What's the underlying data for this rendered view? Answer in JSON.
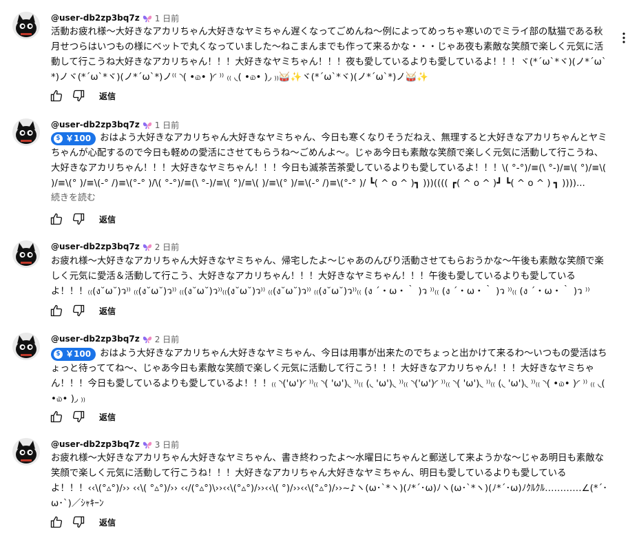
{
  "comments": [
    {
      "author": "@user-db2zp3bq7z",
      "time": "1 日前",
      "text": "活動お疲れ様〜大好きなアカリちゃん大好きなヤミちゃん遅くなってごめんね〜例によってめっちゃ寒いのでミライ部の駄猫である秋月せつらはいつもの様にベットで丸くなっていました〜ねこまんまでも作って来るかな・・・じゃあ夜も素敵な笑顔で楽しく元気に活動して行こうね大好きなアカリちゃん！！！大好きなヤミちゃん！！！夜も愛しているよりも愛しているよ！！！ヾ(*´ω`*ヾ)(ノ*´ω`*)ノヾ(*´ω`*ヾ)(ノ*´ω`*)ノ⁽⁽ ◝( •௰• )◜ ⁾⁾ ₍₍ ◟( •௰• )◞ ₎₎🥁✨ヾ(*´ω`*ヾ)(ノ*´ω`*)ノ🥁✨",
      "superchat": "",
      "read_more": "",
      "reply": "返信"
    },
    {
      "author": "@user-db2zp3bq7z",
      "time": "1 日前",
      "superchat": "￥100",
      "text": "おはよう大好きなアカリちゃん大好きなヤミちゃん、今日も寒くなりそうだねえ、無理すると大好きなアカリちゃんとヤミちゃんが心配するので今日も軽めの愛活にさせてもらうね〜ごめんよ〜。じゃあ今日も素敵な笑顔で楽しく元気に活動して行こうね、大好きなアカリちゃん！！！大好きなヤミちゃん！！！今日も滅茶苦茶愛しているよりも愛しているよ！！！\\( °-°)/≡(\\ °-)/≡\\( °)/≡\\( )/≡\\(° )/≡\\(-° /)≡\\(°-° )/\\( °-°)/≡(\\ °-)/≡\\( °)/≡\\( )/≡\\(° )/≡\\(-° /)≡\\(°-° )/ ┗( ^ o ^ )┓ )))(((( ┏( ^ o ^ )┛ ┗( ^ o ^ ) ┓ ))))...",
      "read_more": "続きを読む",
      "reply": "返信"
    },
    {
      "author": "@user-db2zp3bq7z",
      "time": "2 日前",
      "text": "お疲れ様〜大好きなアカリちゃん大好きなヤミちゃん、帰宅したよ〜じゃあのんびり活動させてもらおうかな〜午後も素敵な笑顔で楽しく元気に愛活＆活動して行こう、大好きなアカリちゃん！！！大好きなヤミちゃん！！！午後も愛しているよりも愛しているよ！！！₍₍(ง˘ω˘)ว⁾⁾ ₍₍(ง˘ω˘)ว⁾⁾ ₍₍(ง˘ω˘)ว⁾⁾₍₍(ง˘ω˘)ว⁾⁾ ₍₍(ง˘ω˘)ว⁾⁾ ₍₍(ง˘ω˘)ว⁾⁾₍₍ (ง ´・ω・｀ )ว ⁾⁾₍₍ (ง ´・ω・｀ )ว ⁾⁾₍₍ (ง ´・ω・｀ )ว ⁾⁾",
      "superchat": "",
      "read_more": "",
      "reply": "返信"
    },
    {
      "author": "@user-db2zp3bq7z",
      "time": "2 日前",
      "superchat": "￥100",
      "text": "おはよう大好きなアカリちゃん大好きなヤミちゃん、今日は用事が出来たのでちょっと出かけて来るわ〜いつもの愛活はちょっと待っててね〜、じゃあ今日も素敵な笑顔で楽しく元気に活動して行こう！！！大好きなアカリちゃん！！！大好きなヤミちゃん！！！今日も愛しているよりも愛しているよ！！！₍₍ ◝('ω')◜ ⁾⁾₍₍ ◝( 'ω')◟ ⁾⁾₍₍ (◟ 'ω')◟ ⁾⁾₍₍ ◝('ω')◜ ⁾⁾₍₍ ◝( 'ω')◟ ⁾⁾₍₍ (◟ 'ω')◟ ⁾⁾₍₍ ◝( •௰• )◜ ⁾⁾ ₍₍ ◟( •௰• )◞ ₎₎",
      "read_more": "",
      "reply": "返信"
    },
    {
      "author": "@user-db2zp3bq7z",
      "time": "3 日前",
      "text": "お疲れ様〜大好きなアカリちゃん大好きなヤミちゃん、書き終わったよ〜水曜日にちゃんと郵送して来ようかな〜じゃあ明日も素敵な笑顔で楽しく元気に活動して行こうね！！！大好きなアカリちゃん大好きなヤミちゃん、明日も愛しているよりも愛しているよ！！！‹‹\\(°▵°)/›› ‹‹\\( °▵°)/›› ‹‹/(°▵°)\\››‹‹\\(°▵°)/››‹‹\\( °)/››‹‹\\(°▵°)/››~♪ヽ(ω･`*ヽ)(ﾉ*´･ω)ﾉヽ(ω･`*ヽ)(ﾉ*´･ω)ﾉｸﾙｸﾙ…………∠(*´･ω･`)／ｼｬｷｰﾝ",
      "superchat": "",
      "read_more": "",
      "reply": "返信"
    }
  ],
  "colors": {
    "superchat": "#1a73e8",
    "time": "#606060",
    "badge": "#8d6cf1"
  },
  "icons": {
    "avatar": "black-cat-avatar",
    "badge": "butterfly-icon",
    "like": "thumbs-up-icon",
    "dislike": "thumbs-down-icon",
    "menu": "more-vert-icon"
  }
}
